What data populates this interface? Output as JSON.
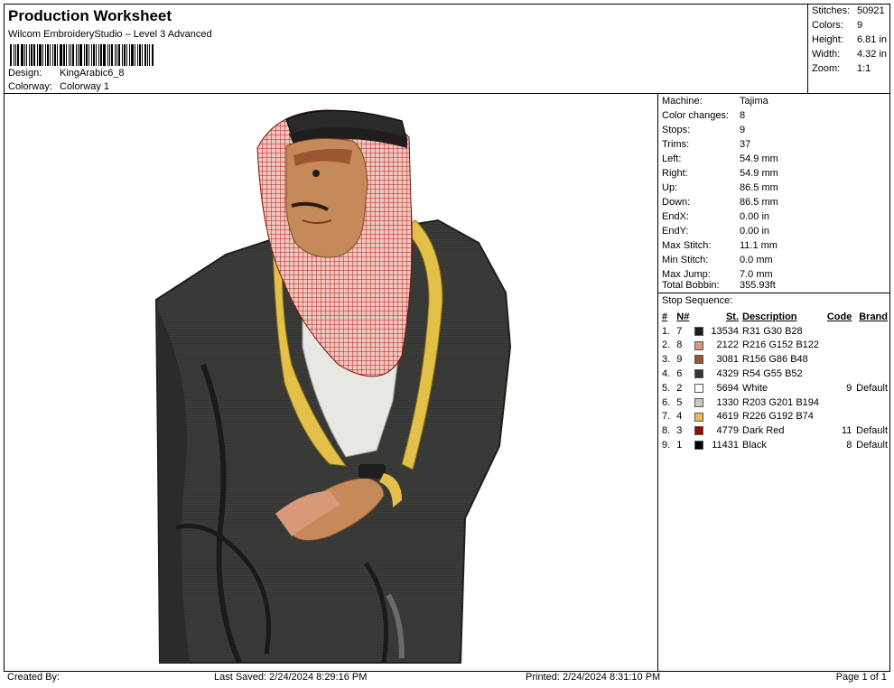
{
  "header": {
    "title": "Production Worksheet",
    "subtitle": "Wilcom EmbroideryStudio – Level 3 Advanced",
    "design_label": "Design:",
    "design_value": "KingArabic6_8",
    "colorway_label": "Colorway:",
    "colorway_value": "Colorway 1"
  },
  "stats": [
    {
      "label": "Stitches:",
      "value": "50921"
    },
    {
      "label": "Colors:",
      "value": "9"
    },
    {
      "label": "Height:",
      "value": "6.81 in"
    },
    {
      "label": "Width:",
      "value": "4.32 in"
    },
    {
      "label": "Zoom:",
      "value": "1:1"
    }
  ],
  "machine": [
    {
      "label": "Machine:",
      "value": "Tajima"
    },
    {
      "label": "Color changes:",
      "value": "8"
    },
    {
      "label": "Stops:",
      "value": "9"
    },
    {
      "label": "Trims:",
      "value": "37"
    },
    {
      "label": "Left:",
      "value": "54.9 mm"
    },
    {
      "label": "Right:",
      "value": "54.9 mm"
    },
    {
      "label": "Up:",
      "value": "86.5 mm"
    },
    {
      "label": "Down:",
      "value": "86.5 mm"
    },
    {
      "label": "EndX:",
      "value": "0.00 in"
    },
    {
      "label": "EndY:",
      "value": "0.00 in"
    },
    {
      "label": "Max Stitch:",
      "value": "11.1 mm"
    },
    {
      "label": "Min Stitch:",
      "value": "0.0 mm"
    },
    {
      "label": "Max Jump:",
      "value": "7.0 mm"
    },
    {
      "label": "Total Bobbin:",
      "value": "355.93ft"
    }
  ],
  "sequence": {
    "title": "Stop Sequence:",
    "headers": {
      "num": "#",
      "n": "N#",
      "st": "St.",
      "desc": "Description",
      "code": "Code",
      "brand": "Brand"
    },
    "rows": [
      {
        "num": "1.",
        "n": "7",
        "color": "#1f1e1c",
        "st": "13534",
        "desc": "R31 G30 B28",
        "code": "",
        "brand": ""
      },
      {
        "num": "2.",
        "n": "8",
        "color": "#d8987a",
        "st": "2122",
        "desc": "R216 G152 B122",
        "code": "",
        "brand": ""
      },
      {
        "num": "3.",
        "n": "9",
        "color": "#9c5630",
        "st": "3081",
        "desc": "R156 G86 B48",
        "code": "",
        "brand": ""
      },
      {
        "num": "4.",
        "n": "6",
        "color": "#363734",
        "st": "4329",
        "desc": "R54 G55 B52",
        "code": "",
        "brand": ""
      },
      {
        "num": "5.",
        "n": "2",
        "color": "#ffffff",
        "st": "5694",
        "desc": "White",
        "code": "9",
        "brand": "Default"
      },
      {
        "num": "6.",
        "n": "5",
        "color": "#cbc9c2",
        "st": "1330",
        "desc": "R203 G201 B194",
        "code": "",
        "brand": ""
      },
      {
        "num": "7.",
        "n": "4",
        "color": "#e2c04a",
        "st": "4619",
        "desc": "R226 G192 B74",
        "code": "",
        "brand": ""
      },
      {
        "num": "8.",
        "n": "3",
        "color": "#9a0a0a",
        "st": "4779",
        "desc": "Dark Red",
        "code": "11",
        "brand": "Default"
      },
      {
        "num": "9.",
        "n": "1",
        "color": "#000000",
        "st": "11431",
        "desc": "Black",
        "code": "8",
        "brand": "Default"
      }
    ]
  },
  "footer": {
    "created_by": "Created By:",
    "last_saved": "Last Saved: 2/24/2024 8:29:16 PM",
    "printed": "Printed: 2/24/2024 8:31:10 PM",
    "page": "Page 1 of 1"
  },
  "colors": {
    "robe": "#3a3b38",
    "robe_dark": "#1f1e1c",
    "trim": "#e2c04a",
    "skin": "#c68a5a",
    "skin_dark": "#9c5630",
    "shirt": "#e8e8e2",
    "headscarf": "#e6b0a8",
    "check": "#b02020"
  },
  "icons": {
    "barcode": "barcode-icon"
  }
}
